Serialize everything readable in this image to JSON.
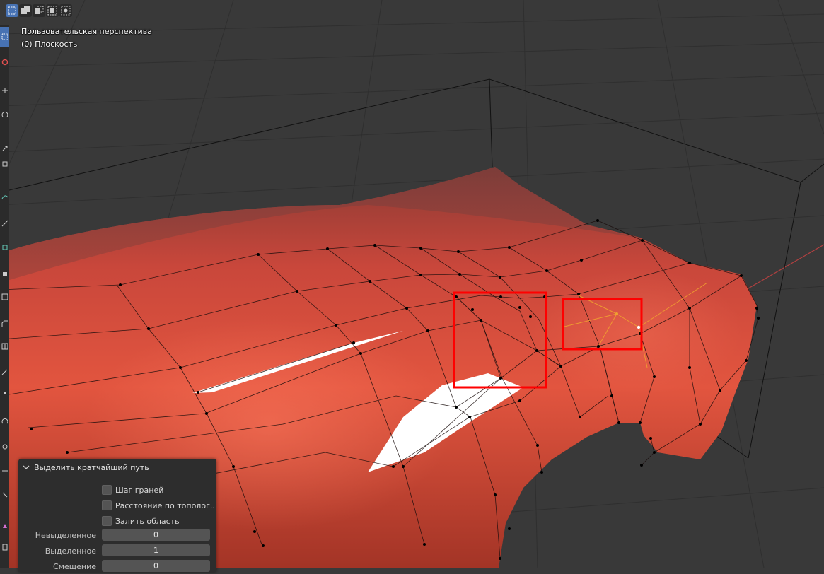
{
  "viewport": {
    "view_name": "Пользовательская перспектива",
    "object_name": "(0) Плоскость"
  },
  "header": {
    "selection_modes": [
      "new-selection-icon",
      "extend-selection-icon",
      "subtract-selection-icon",
      "invert-selection-icon",
      "intersect-selection-icon"
    ]
  },
  "toolbar": {
    "tools": [
      "select-box-icon",
      "cursor-icon",
      "move-icon",
      "rotate-icon",
      "scale-icon",
      "transform-icon",
      "annotate-icon",
      "measure-icon",
      "add-cube-icon",
      "extrude-icon",
      "inset-icon",
      "bevel-icon",
      "loop-cut-icon",
      "knife-icon",
      "poly-build-icon",
      "spin-icon",
      "smooth-icon",
      "edge-slide-icon",
      "shrink-icon",
      "shear-icon",
      "rip-icon"
    ]
  },
  "operator_panel": {
    "title": "Выделить кратчайший путь",
    "options": [
      {
        "label": "Шаг граней",
        "checked": false
      },
      {
        "label": "Расстояние по тополог...",
        "checked": false
      },
      {
        "label": "Залить область",
        "checked": false
      }
    ],
    "fields": [
      {
        "label": "Невыделенное",
        "value": "0"
      },
      {
        "label": "Выделенное",
        "value": "1"
      },
      {
        "label": "Смещение",
        "value": "0"
      }
    ]
  },
  "colors": {
    "viewport_bg": "#393939",
    "mesh_red": "#d2483a",
    "highlight_box": "#ff0000",
    "active_tool": "#4772b3",
    "selection_orange": "#f0a030"
  }
}
